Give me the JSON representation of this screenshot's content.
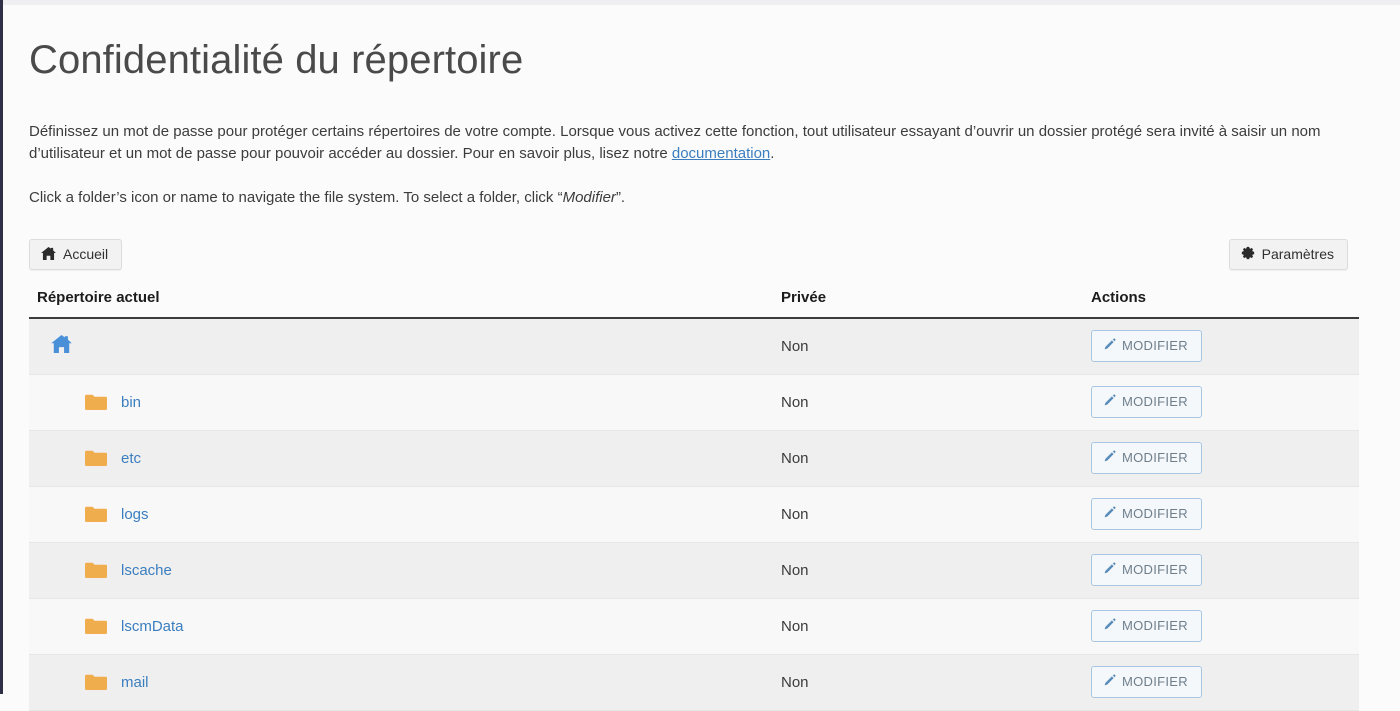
{
  "page": {
    "title": "Confidentialité du répertoire",
    "description_part1": "Définissez un mot de passe pour protéger certains répertoires de votre compte. Lorsque vous activez cette fonction, tout utilisateur essayant d’ouvrir un dossier protégé sera invité à saisir un nom d’utilisateur et un mot de passe pour pouvoir accéder au dossier. Pour en savoir plus, lisez notre ",
    "description_link": "documentation",
    "description_part2": ".",
    "instruction_prefix": "Click a folder’s icon or name to navigate the file system. To select a folder, click “",
    "instruction_emphasis": "Modifier",
    "instruction_suffix": "”."
  },
  "toolbar": {
    "home_button": "Accueil",
    "home_icon": "home-icon",
    "settings_button": "Paramètres",
    "settings_icon": "gear-icon"
  },
  "table": {
    "headers": {
      "directory": "Répertoire actuel",
      "private": "Privée",
      "actions": "Actions"
    },
    "action_label": "MODIFIER",
    "action_icon": "pencil-icon",
    "rows": [
      {
        "name": "",
        "icon": "home-icon",
        "is_home": true,
        "private": "Non",
        "action": "MODIFIER"
      },
      {
        "name": "bin",
        "icon": "folder-icon",
        "is_home": false,
        "private": "Non",
        "action": "MODIFIER"
      },
      {
        "name": "etc",
        "icon": "folder-icon",
        "is_home": false,
        "private": "Non",
        "action": "MODIFIER"
      },
      {
        "name": "logs",
        "icon": "folder-icon",
        "is_home": false,
        "private": "Non",
        "action": "MODIFIER"
      },
      {
        "name": "lscache",
        "icon": "folder-icon",
        "is_home": false,
        "private": "Non",
        "action": "MODIFIER"
      },
      {
        "name": "lscmData",
        "icon": "folder-icon",
        "is_home": false,
        "private": "Non",
        "action": "MODIFIER"
      },
      {
        "name": "mail",
        "icon": "folder-icon",
        "is_home": false,
        "private": "Non",
        "action": "MODIFIER"
      }
    ]
  },
  "colors": {
    "link": "#3b7ebf",
    "folder": "#f0ad4e",
    "home_icon": "#4a90d9",
    "row_odd": "#efefef",
    "row_even": "#f8f8f8",
    "left_rail": "#2f2f47"
  }
}
